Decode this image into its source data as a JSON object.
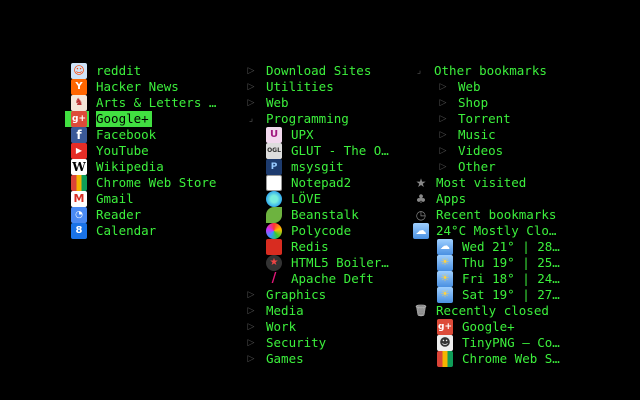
{
  "col1": [
    {
      "label": "reddit",
      "icon": "reddit-icon"
    },
    {
      "label": "Hacker News",
      "icon": "hacker-news-icon"
    },
    {
      "label": "Arts & Letters …",
      "icon": "arts-letters-icon"
    },
    {
      "label": "Google+",
      "icon": "google-plus-icon",
      "selected": true
    },
    {
      "label": "Facebook",
      "icon": "facebook-icon"
    },
    {
      "label": "YouTube",
      "icon": "youtube-icon"
    },
    {
      "label": "Wikipedia",
      "icon": "wikipedia-icon"
    },
    {
      "label": "Chrome Web Store",
      "icon": "chrome-web-store-icon"
    },
    {
      "label": "Gmail",
      "icon": "gmail-icon"
    },
    {
      "label": "Reader",
      "icon": "reader-icon"
    },
    {
      "label": "Calendar",
      "icon": "calendar-icon"
    }
  ],
  "col2": {
    "download_sites": "Download Sites",
    "utilities": "Utilities",
    "web": "Web",
    "programming": "Programming",
    "programming_items": [
      {
        "label": "UPX",
        "icon": "upx-icon",
        "glyph": "U"
      },
      {
        "label": "GLUT - The O…",
        "icon": "glut-icon",
        "glyph": "OGL"
      },
      {
        "label": "msysgit",
        "icon": "msysgit-icon",
        "glyph": "P"
      },
      {
        "label": "Notepad2",
        "icon": "notepad2-icon",
        "glyph": ""
      },
      {
        "label": "LÖVE",
        "icon": "love-icon",
        "glyph": ""
      },
      {
        "label": "Beanstalk",
        "icon": "beanstalk-icon",
        "glyph": ""
      },
      {
        "label": "Polycode",
        "icon": "polycode-icon",
        "glyph": ""
      },
      {
        "label": "Redis",
        "icon": "redis-icon",
        "glyph": ""
      },
      {
        "label": "HTML5 Boiler…",
        "icon": "html5-boilerplate-icon",
        "glyph": "★"
      },
      {
        "label": "Apache Deft",
        "icon": "apache-deft-icon",
        "glyph": ""
      }
    ],
    "graphics": "Graphics",
    "media": "Media",
    "work": "Work",
    "security": "Security",
    "games": "Games"
  },
  "col3": {
    "other_bookmarks": "Other bookmarks",
    "other_items": [
      "Web",
      "Shop",
      "Torrent",
      "Music",
      "Videos",
      "Other"
    ],
    "most_visited": "Most visited",
    "apps": "Apps",
    "recent_bookmarks": "Recent bookmarks",
    "weather_current": "24°C Mostly Clo…",
    "forecast": [
      "Wed 21° | 28…",
      "Thu 19° | 25…",
      "Fri 18° | 24…",
      "Sat 19° | 27…"
    ],
    "recently_closed": "Recently closed",
    "closed_items": [
      {
        "label": "Google+",
        "icon": "google-plus-icon"
      },
      {
        "label": "TinyPNG – Co…",
        "icon": "tinypng-icon"
      },
      {
        "label": "Chrome Web S…",
        "icon": "chrome-web-store-icon"
      }
    ]
  },
  "colors": {
    "accent": "#3cf03c",
    "selected_bg": "#41e041",
    "background": "#000000"
  }
}
